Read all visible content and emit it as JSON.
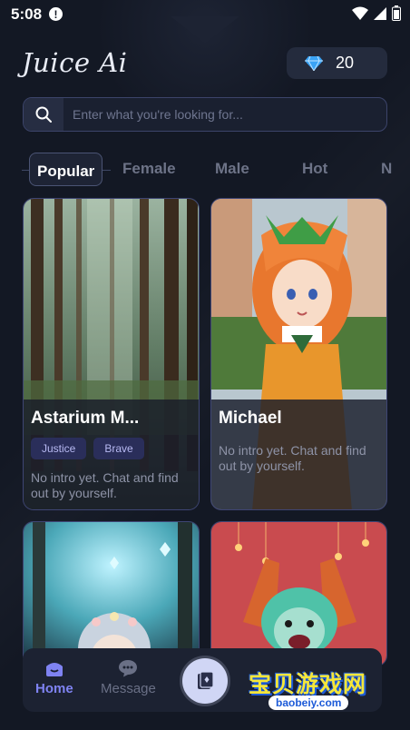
{
  "status_bar": {
    "time": "5:08",
    "alert": "!"
  },
  "header": {
    "logo": "Juice Ai",
    "gems": "20",
    "gem_icon": "diamond-icon"
  },
  "search": {
    "placeholder": "Enter what you're looking for..."
  },
  "tabs": [
    "Popular",
    "Female",
    "Male",
    "Hot",
    "N"
  ],
  "cards": [
    {
      "name": "Astarium M...",
      "tags": [
        "Justice",
        "Brave"
      ],
      "intro": "No intro yet. Chat and find out by yourself."
    },
    {
      "name": "Michael",
      "tags": [],
      "intro": "No intro yet. Chat and find out by yourself."
    },
    {
      "name": "",
      "tags": [],
      "intro": ""
    },
    {
      "name": "",
      "tags": [],
      "intro": ""
    }
  ],
  "bottom_nav": {
    "home": "Home",
    "message": "Message"
  },
  "watermark": {
    "text": "宝贝游戏网",
    "sub": "baobeiy.com"
  },
  "colors": {
    "background": "#131824",
    "accent": "#7f83f2",
    "card_border": "#3e4574",
    "tag_bg": "#2a2e5a"
  }
}
